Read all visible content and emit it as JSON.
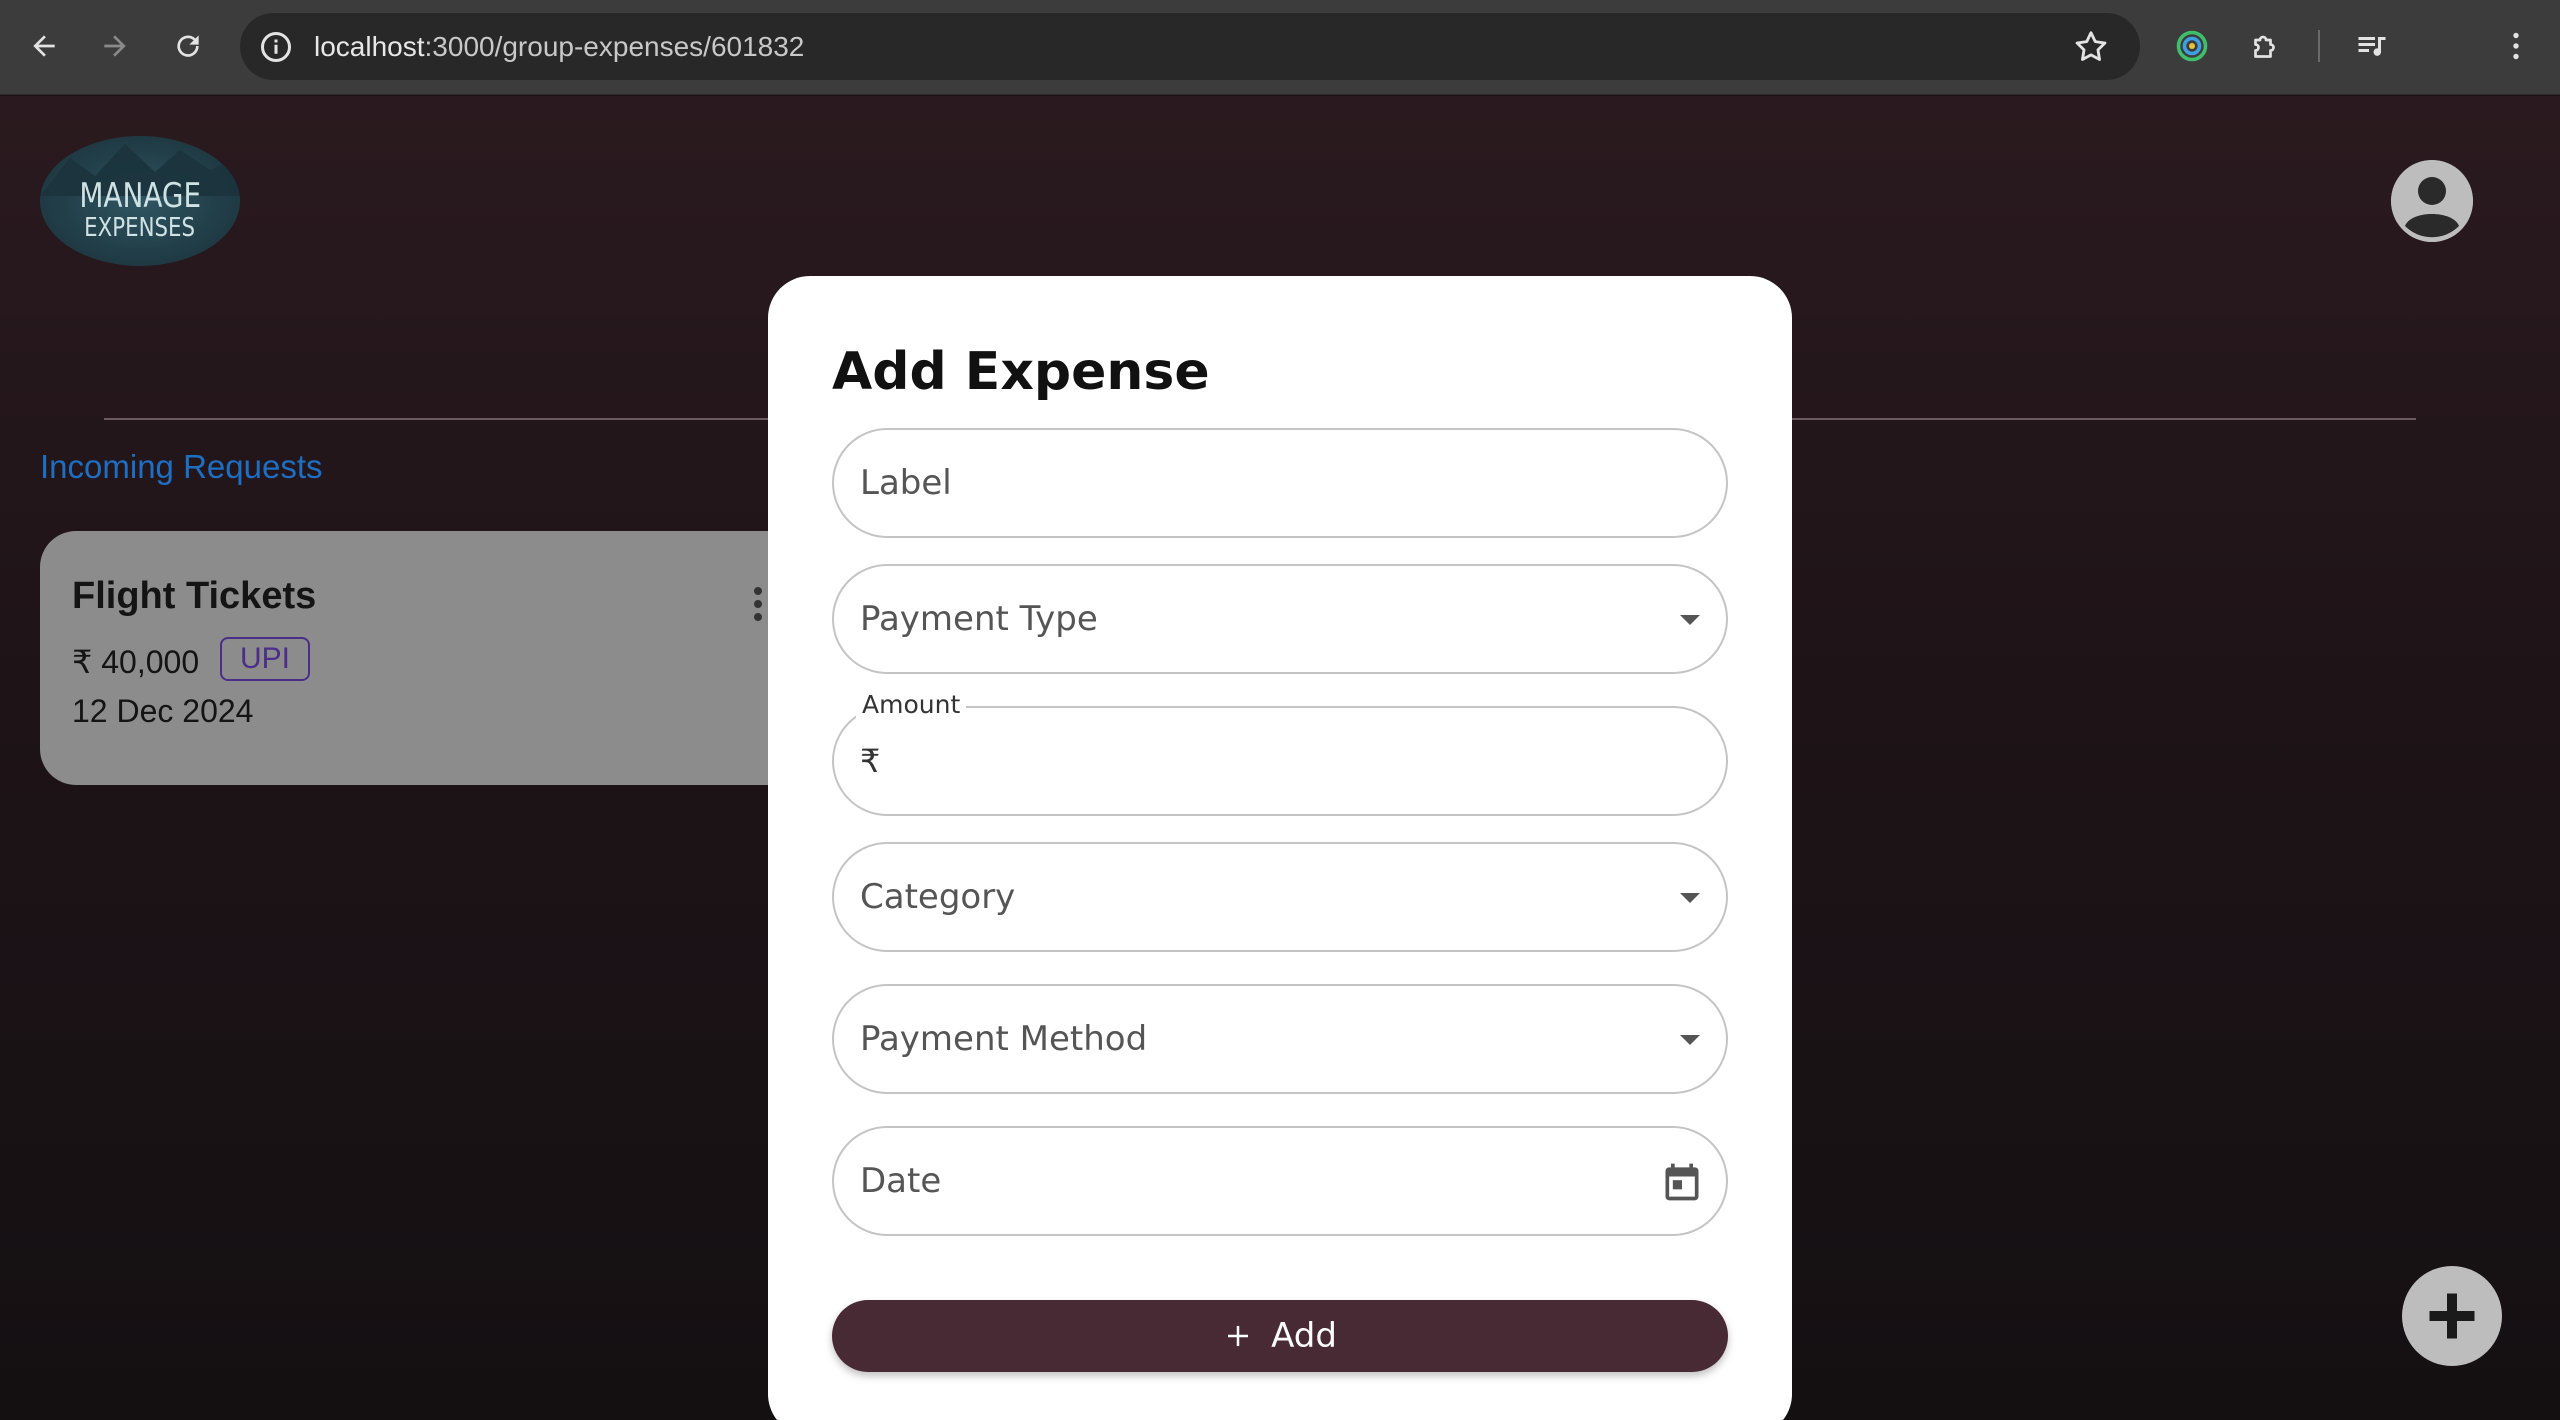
{
  "browser": {
    "url_host": "localhost",
    "url_path": ":3000/group-expenses/601832"
  },
  "app": {
    "logo_line1": "MANAGE",
    "logo_line2": "EXPENSES",
    "section_title": "Incoming Requests"
  },
  "card": {
    "title": "Flight Tickets",
    "amount": "₹ 40,000",
    "badge": "UPI",
    "date": "12 Dec 2024"
  },
  "modal": {
    "title": "Add Expense",
    "fields": {
      "label_placeholder": "Label",
      "payment_type_placeholder": "Payment Type",
      "amount_label": "Amount",
      "amount_prefix": "₹",
      "amount_value": "",
      "category_placeholder": "Category",
      "payment_method_placeholder": "Payment Method",
      "date_placeholder": "Date"
    },
    "submit_label": "Add"
  }
}
